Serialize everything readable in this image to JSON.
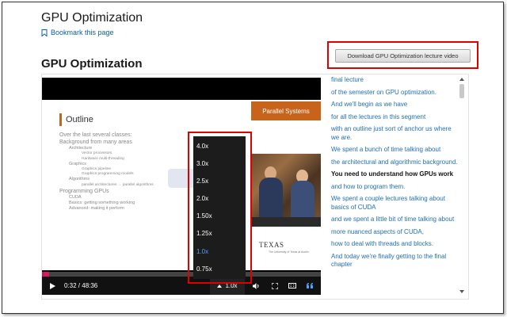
{
  "page": {
    "title": "GPU Optimization",
    "bookmark_label": "Bookmark this page",
    "section_title": "GPU Optimization",
    "download_label": "Download GPU Optimization lecture video"
  },
  "slide": {
    "header": "Parallel Systems",
    "heading": "Outline",
    "lines": [
      {
        "level": 1,
        "text": "Over the last several classes:"
      },
      {
        "level": 1,
        "text": "Background from many areas"
      },
      {
        "level": 2,
        "text": "Architecture"
      },
      {
        "level": 3,
        "text": "Vector processors"
      },
      {
        "level": 3,
        "text": "Hardware multi-threading"
      },
      {
        "level": 2,
        "text": "Graphics"
      },
      {
        "level": 3,
        "text": "Graphics pipeline"
      },
      {
        "level": 3,
        "text": "Graphics programming models"
      },
      {
        "level": 2,
        "text": "Algorithms"
      },
      {
        "level": 3,
        "text": "parallel architectures → parallel algorithms"
      },
      {
        "level": 1,
        "text": "Programming GPUs"
      },
      {
        "level": 2,
        "text": "CUDA"
      },
      {
        "level": 2,
        "text": "Basics: getting something working"
      },
      {
        "level": 2,
        "text": "Advanced: making it perform"
      }
    ],
    "logo_text": "TEXAS",
    "logo_subtext": "The University of Texas at Austin"
  },
  "player": {
    "time": "0:32 / 48:36",
    "progress_fraction": 0.011,
    "speed_label": "1.0x",
    "speed_options": [
      "4.0x",
      "3.0x",
      "2.5x",
      "2.0x",
      "1.50x",
      "1.25x",
      "1.0x",
      "0.75x"
    ],
    "selected_speed": "1.0x",
    "icons": [
      "play-icon",
      "chevron-up-icon",
      "volume-icon",
      "fullscreen-icon",
      "closed-captions-icon",
      "transcript-quote-icon"
    ]
  },
  "transcript": {
    "lines": [
      {
        "text": "final lecture",
        "current": false
      },
      {
        "text": "of the semester on GPU optimization.",
        "current": false
      },
      {
        "text": "And we'll begin as we have",
        "current": false
      },
      {
        "text": "for all the lectures in this segment",
        "current": false
      },
      {
        "text": "with an outline just sort of anchor us where we are.",
        "current": false
      },
      {
        "text": "We spent a bunch of time talking about",
        "current": false
      },
      {
        "text": "the architectural and algorithmic background.",
        "current": false
      },
      {
        "text": "You need to understand how GPUs work",
        "current": true
      },
      {
        "text": "and how to program them.",
        "current": false
      },
      {
        "text": "We spent a couple lectures talking about basics of CUDA",
        "current": false
      },
      {
        "text": "and we spent a little bit of time talking about",
        "current": false
      },
      {
        "text": "more nuanced aspects of CUDA,",
        "current": false
      },
      {
        "text": "how to deal with threads and blocks.",
        "current": false
      },
      {
        "text": "And today we're finally getting to the final chapter",
        "current": false
      }
    ]
  },
  "colors": {
    "accent_orange": "#c8631b",
    "link_blue": "#1f6fb5",
    "highlight_red": "#e00000",
    "progress_pink": "#c2185b",
    "selected_speed_blue": "#4da3ff"
  }
}
